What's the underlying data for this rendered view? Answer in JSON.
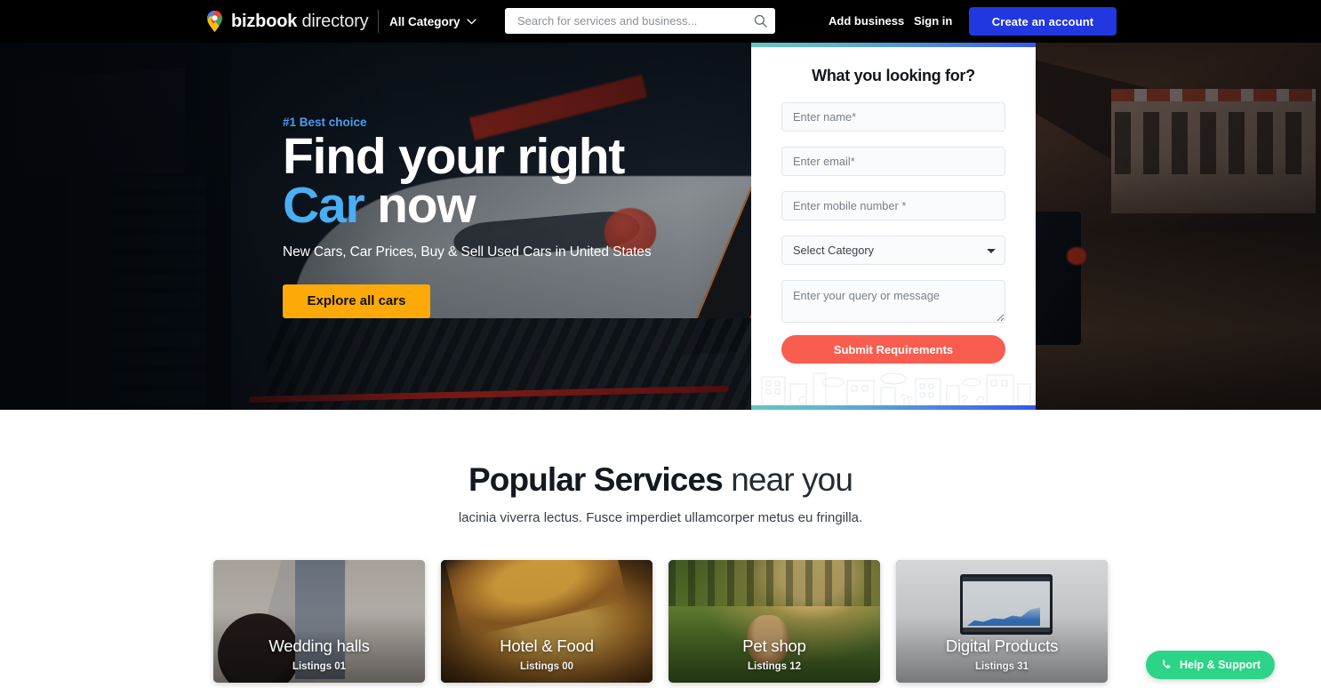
{
  "header": {
    "logo": {
      "icon": "map-pin-icon",
      "name_bold": "bizbook",
      "name_light": " directory"
    },
    "category_selector": {
      "label": "All Category",
      "icon": "chevron-down-icon"
    },
    "search": {
      "placeholder": "Search for services and business...",
      "value": "",
      "icon": "search-icon"
    },
    "links": [
      {
        "label": "Add business"
      },
      {
        "label": "Sign in"
      }
    ],
    "cta": {
      "label": "Create an account",
      "color": "#2137e0"
    }
  },
  "hero": {
    "badge": "#1 Best choice",
    "title_line1": "Find your right",
    "title_accent": "Car",
    "title_rest": " now",
    "subtitle": "New Cars, Car Prices, Buy & Sell Used Cars in United States",
    "cta": {
      "label": "Explore all cars",
      "color": "#fdaa08"
    }
  },
  "lead_form": {
    "title": "What you looking for?",
    "accent_gradient_from": "#64c6bd",
    "accent_gradient_to": "#3657ee",
    "fields": [
      {
        "name": "name",
        "placeholder": "Enter name*",
        "value": ""
      },
      {
        "name": "email",
        "placeholder": "Enter email*",
        "value": ""
      },
      {
        "name": "mobile",
        "placeholder": "Enter mobile number *",
        "value": ""
      }
    ],
    "category": {
      "placeholder": "Select Category",
      "selected": "Select Category",
      "icon": "chevron-down-icon"
    },
    "message": {
      "placeholder": "Enter your query or message",
      "value": ""
    },
    "submit": {
      "label": "Submit Requirements",
      "color": "#f95d4f"
    }
  },
  "services": {
    "title_bold": "Popular Services",
    "title_rest": " near you",
    "subtitle": "lacinia viverra lectus. Fusce imperdiet ullamcorper metus eu fringilla.",
    "cards": [
      {
        "label": "Wedding halls",
        "count": "Listings 01",
        "art": "art-wedding"
      },
      {
        "label": "Hotel & Food",
        "count": "Listings 00",
        "art": "art-food"
      },
      {
        "label": "Pet shop",
        "count": "Listings 12",
        "art": "art-pet"
      },
      {
        "label": "Digital Products",
        "count": "Listings 31",
        "art": "art-digital"
      }
    ]
  },
  "help_widget": {
    "label": "Help & Support",
    "icon": "phone-icon",
    "color": "#2bd486"
  }
}
